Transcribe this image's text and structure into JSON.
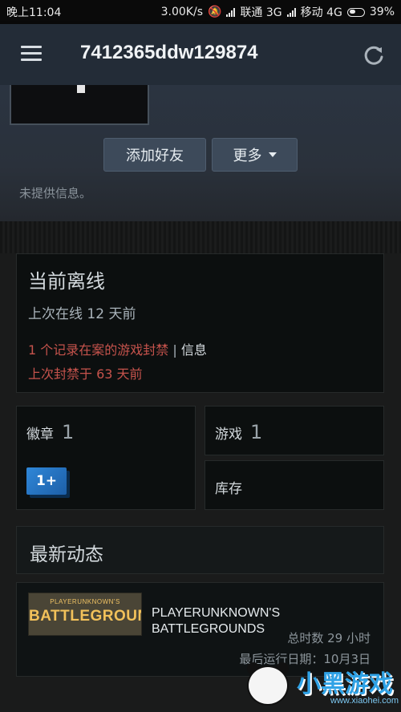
{
  "statusbar": {
    "time": "晚上11:04",
    "speed": "3.00K/s",
    "carrier1": "联通 3G",
    "carrier2": "移动 4G",
    "battery": "39%"
  },
  "header": {
    "title": "7412365ddw129874",
    "menu_icon": "hamburger-menu-icon",
    "refresh_icon": "refresh-icon"
  },
  "profile": {
    "add_friend": "添加好友",
    "more": "更多",
    "no_info": "未提供信息。"
  },
  "status": {
    "title": "当前离线",
    "last_online": "上次在线 12 天前",
    "ban_text": "1 个记录在案的游戏封禁",
    "separator": " | ",
    "ban_info": "信息",
    "last_ban": "上次封禁于 63 天前"
  },
  "stats": {
    "badges_label": "徽章",
    "badges_count": "1",
    "badge_icon_text": "1+",
    "games_label": "游戏",
    "games_count": "1",
    "inventory_label": "库存"
  },
  "activity": {
    "title": "最新动态",
    "game": {
      "logo_small": "PLAYERUNKNOWN'S",
      "logo_big": "BATTLEGROUNDS",
      "name": "PLAYERUNKNOWN'S BATTLEGROUNDS",
      "playtime": "总时数 29 小时",
      "last_run": "最后运行日期：10月3日"
    }
  },
  "watermark": {
    "text": "小黑游戏",
    "url": "www.xiaohei.com"
  },
  "colors": {
    "header_bg": "#232c37",
    "ban_red": "#c6534c",
    "badge_blue": "#2f87d8",
    "logo_gold": "#f2c15a"
  }
}
